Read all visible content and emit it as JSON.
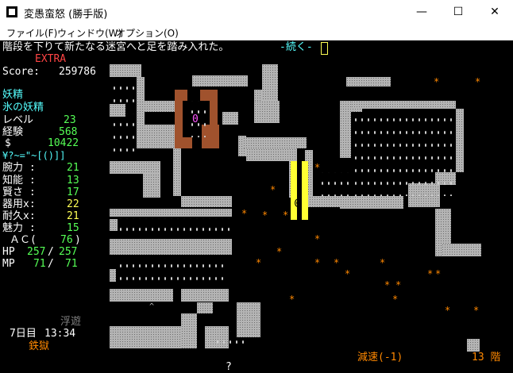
{
  "window": {
    "title": "変愚蛮怒 (勝手版)",
    "minimize": "—",
    "maximize": "☐",
    "close": "✕"
  },
  "menu": [
    "ファイル(F)",
    "ウィンドウ(W)",
    "オプション(O)"
  ],
  "message": "階段を下りて新たなる迷宮へと足を踏み入れた。",
  "more": "-続く-",
  "status": {
    "mode": "EXTRA",
    "score_label": "Score:",
    "score_value": "259786",
    "race": "妖精",
    "class": "氷の妖精",
    "level_label": "レベル",
    "level_value": "23",
    "exp_label": "経験",
    "exp_value": "568",
    "gold_label": "$",
    "gold_value": "10422",
    "equip": "¥?~=\"~[()]]",
    "str_label": "腕力 :",
    "str_value": "21",
    "int_label": "知能 :",
    "int_value": "13",
    "wis_label": "賢さ :",
    "wis_value": "17",
    "dex_label": "器用x:",
    "dex_value": "22",
    "con_label": "耐久x:",
    "con_value": "21",
    "chr_label": "魅力 :",
    "chr_value": "15",
    "ac_label": "ＡＣ(",
    "ac_value": "76",
    "ac_close": ")",
    "hp_label": "HP",
    "hp_cur": "257",
    "hp_max": "257",
    "mp_label": "MP",
    "mp_cur": "71",
    "mp_max": "71",
    "levitation": "浮遊",
    "day": "7日目",
    "time": "13:34",
    "location": "鉄獄"
  },
  "bottom": {
    "slow": "減速(-1)",
    "depth": "13 階"
  },
  "map_symbols": {
    "monster": "0",
    "player": "@",
    "unknown": "?",
    "trap": "^"
  }
}
